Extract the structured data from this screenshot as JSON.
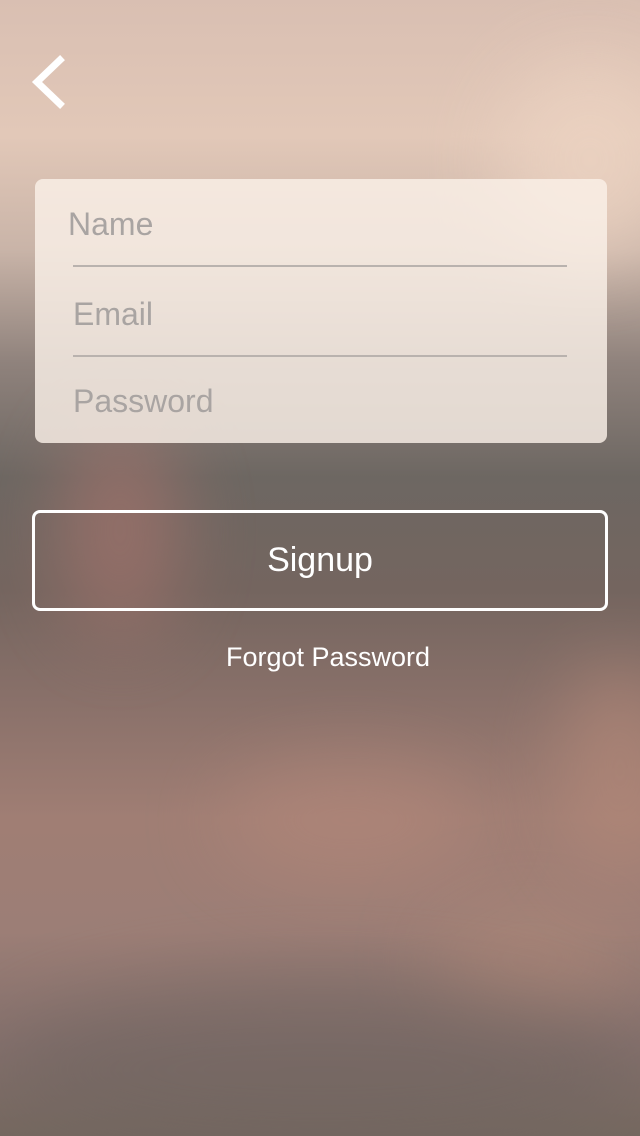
{
  "header": {
    "back_icon": "chevron-left-icon"
  },
  "form": {
    "name_placeholder": "Name",
    "email_placeholder": "Email",
    "password_placeholder": "Password"
  },
  "actions": {
    "signup_label": "Signup",
    "forgot_password_label": "Forgot Password"
  },
  "colors": {
    "button_border": "#ffffff",
    "card_background": "#faf0e8",
    "placeholder_text": "#a9a4a2"
  }
}
